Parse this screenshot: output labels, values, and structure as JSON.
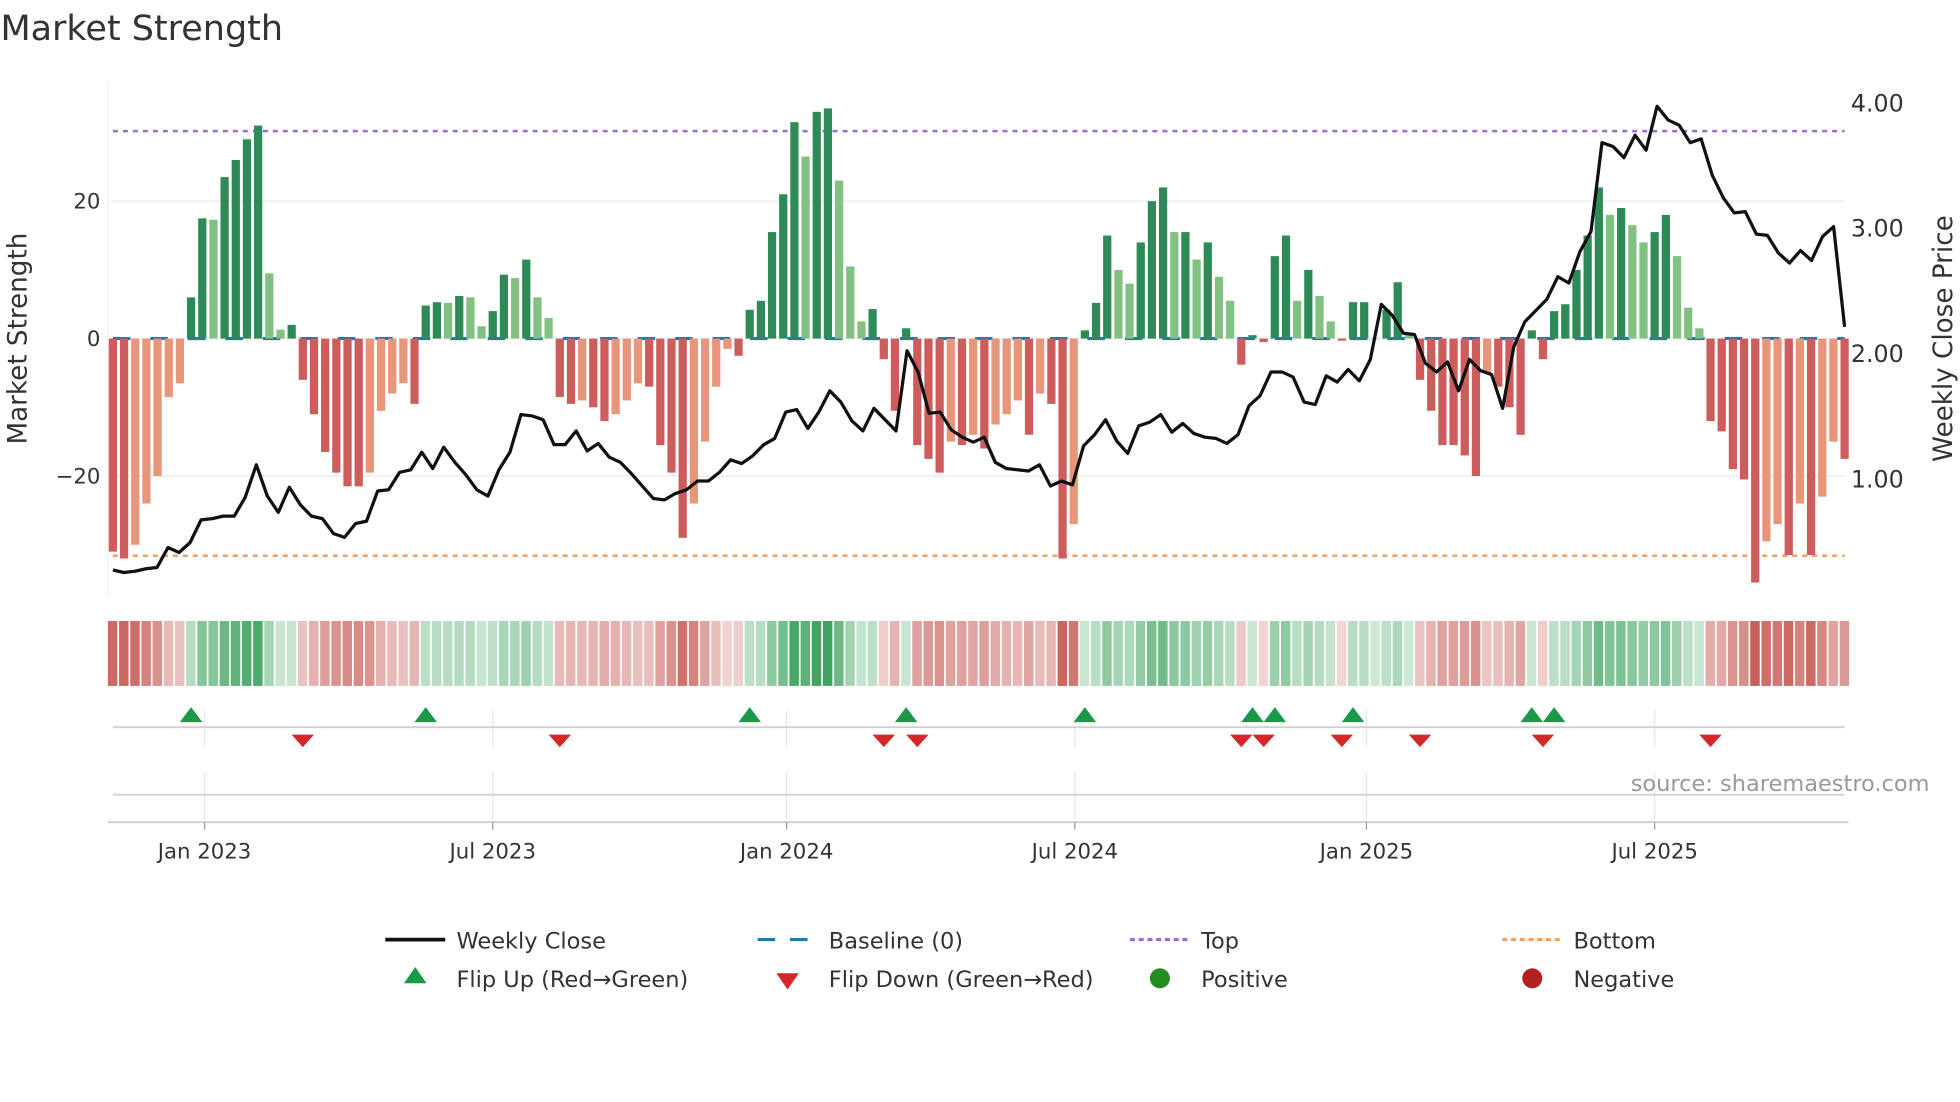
{
  "chart_data": {
    "type": "bar",
    "title": "Market Strength",
    "ylabel": "Market Strength",
    "y2label": "Weekly Close Price",
    "ylim": [
      -37,
      38
    ],
    "y2lim": [
      0.1,
      4.2
    ],
    "y_ticks": [
      {
        "v": 20,
        "label": "20"
      },
      {
        "v": 0,
        "label": "0"
      },
      {
        "v": -20,
        "label": "−20"
      }
    ],
    "y2_ticks": [
      {
        "v": 4,
        "label": "4.00"
      },
      {
        "v": 3,
        "label": "3.00"
      },
      {
        "v": 2,
        "label": "2.00"
      },
      {
        "v": 1,
        "label": "1.00"
      }
    ],
    "x_ticks": [
      {
        "week_index": 8.2,
        "label": "Jan 2023"
      },
      {
        "week_index": 34.0,
        "label": "Jul 2023"
      },
      {
        "week_index": 60.3,
        "label": "Jan 2024"
      },
      {
        "week_index": 86.1,
        "label": "Jul 2024"
      },
      {
        "week_index": 112.2,
        "label": "Jan 2025"
      },
      {
        "week_index": 138.0,
        "label": "Jul 2025"
      }
    ],
    "top_level": 30.2,
    "bottom_level": -31.6,
    "baseline": 0,
    "strength": [
      -31,
      -32,
      -30,
      -24,
      -20,
      -8.5,
      -6.5,
      6,
      17.5,
      17.3,
      23.5,
      26,
      29,
      31,
      9.5,
      1.3,
      2,
      -6,
      -11,
      -16.5,
      -19.5,
      -21.5,
      -21.5,
      -19.5,
      -10.5,
      -8,
      -6.5,
      -9.5,
      4.8,
      5.3,
      5.2,
      6.2,
      6,
      1.8,
      4,
      9.3,
      8.8,
      11.5,
      6,
      3,
      -8.5,
      -9.5,
      -9,
      -10,
      -12,
      -11,
      -9,
      -6.5,
      -7,
      -15.5,
      -19.5,
      -29,
      -24,
      -15,
      -7,
      -1.5,
      -2.5,
      4.2,
      5.5,
      15.5,
      21,
      31.5,
      26.5,
      33,
      33.5,
      23,
      10.5,
      2.5,
      4.3,
      -3,
      -10.5,
      1.5,
      -15.5,
      -17.5,
      -19.5,
      -15,
      -15.5,
      -14,
      -16,
      -12.5,
      -11,
      -9,
      -14,
      -8,
      -9.5,
      -32,
      -27,
      1.2,
      5.2,
      15,
      10,
      8,
      14,
      20,
      22,
      15.5,
      15.5,
      11.5,
      14,
      9,
      5.5,
      -3.8,
      0.5,
      -0.5,
      12,
      15,
      5.5,
      10,
      6.2,
      2.5,
      -0.3,
      5.3,
      5.3,
      0,
      4.2,
      8.2,
      0.5,
      -6,
      -10.5,
      -15.5,
      -15.5,
      -17,
      -20,
      -5,
      -7,
      -10,
      -14,
      1.2,
      -3,
      4,
      5,
      10,
      15,
      22,
      18,
      19,
      16.5,
      14,
      15.5,
      18,
      12,
      4.5,
      1.5,
      -12,
      -13.5,
      -19,
      -20.5,
      -35.5,
      -29.5,
      -27,
      -31.5,
      -24,
      -31.5,
      -23,
      -15,
      -17.5
    ],
    "weekly_close": [
      0.27,
      0.25,
      0.26,
      0.28,
      0.29,
      0.45,
      0.41,
      0.49,
      0.67,
      0.68,
      0.7,
      0.7,
      0.85,
      1.11,
      0.86,
      0.73,
      0.93,
      0.79,
      0.7,
      0.68,
      0.56,
      0.53,
      0.64,
      0.66,
      0.9,
      0.91,
      1.05,
      1.07,
      1.21,
      1.08,
      1.25,
      1.13,
      1.03,
      0.91,
      0.86,
      1.07,
      1.21,
      1.51,
      1.5,
      1.47,
      1.27,
      1.27,
      1.38,
      1.22,
      1.28,
      1.17,
      1.13,
      1.04,
      0.94,
      0.84,
      0.83,
      0.88,
      0.91,
      0.98,
      0.98,
      1.05,
      1.15,
      1.12,
      1.18,
      1.27,
      1.32,
      1.53,
      1.55,
      1.4,
      1.53,
      1.7,
      1.61,
      1.46,
      1.38,
      1.56,
      1.47,
      1.38,
      2.02,
      1.85,
      1.52,
      1.53,
      1.39,
      1.33,
      1.29,
      1.33,
      1.13,
      1.08,
      1.07,
      1.06,
      1.11,
      0.94,
      0.98,
      0.95,
      1.26,
      1.35,
      1.47,
      1.3,
      1.2,
      1.42,
      1.45,
      1.51,
      1.37,
      1.44,
      1.36,
      1.33,
      1.32,
      1.28,
      1.35,
      1.58,
      1.66,
      1.85,
      1.85,
      1.81,
      1.61,
      1.59,
      1.82,
      1.77,
      1.87,
      1.78,
      1.95,
      2.39,
      2.3,
      2.16,
      2.15,
      1.92,
      1.85,
      1.93,
      1.7,
      1.95,
      1.86,
      1.83,
      1.56,
      2.05,
      2.25,
      2.34,
      2.43,
      2.61,
      2.56,
      2.81,
      2.97,
      3.68,
      3.65,
      3.56,
      3.74,
      3.62,
      3.97,
      3.86,
      3.82,
      3.68,
      3.71,
      3.42,
      3.24,
      3.12,
      3.13,
      2.95,
      2.94,
      2.8,
      2.72,
      2.82,
      2.74,
      2.93,
      3.01,
      2.21
    ],
    "flip_up_week_index": [
      7,
      28,
      57,
      71,
      87,
      102,
      104,
      111,
      127,
      129
    ],
    "flip_down_week_index": [
      17,
      40,
      69,
      72,
      101,
      103,
      110,
      117,
      128,
      143
    ],
    "legend": [
      {
        "key": "close",
        "label": "Weekly Close"
      },
      {
        "key": "baseline",
        "label": "Baseline (0)"
      },
      {
        "key": "top",
        "label": "Top"
      },
      {
        "key": "bottom",
        "label": "Bottom"
      },
      {
        "key": "flipup",
        "label": "Flip Up (Red→Green)"
      },
      {
        "key": "flipdown",
        "label": "Flip Down (Green→Red)"
      },
      {
        "key": "positive",
        "label": "Positive"
      },
      {
        "key": "negative",
        "label": "Negative"
      }
    ],
    "legend_placement": "bottom",
    "source": "source: sharemaestro.com",
    "colors": {
      "pos_strong": "#2e8b57",
      "pos_weak": "#82c182",
      "neg_strong": "#cd5c5c",
      "neg_weak": "#e8967a",
      "close": "#111111",
      "baseline": "#1f77b4",
      "top": "#9b6bd6",
      "bottom": "#f0a060",
      "flip_up": "#1a9a48",
      "flip_down": "#d62728",
      "positive": "#228b22",
      "negative": "#b22222"
    }
  }
}
